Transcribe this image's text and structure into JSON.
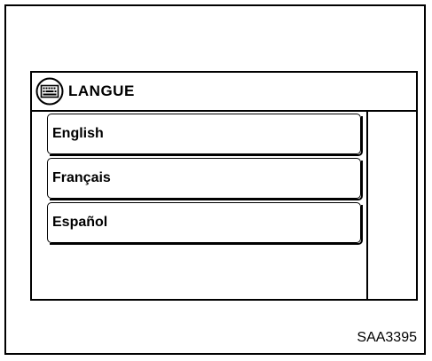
{
  "window": {
    "title": "LANGUE",
    "title_icon": "keyboard-icon"
  },
  "language_list": {
    "items": [
      {
        "label": "English"
      },
      {
        "label": "Français"
      },
      {
        "label": "Español"
      }
    ]
  },
  "footer": {
    "code": "SAA3395"
  }
}
